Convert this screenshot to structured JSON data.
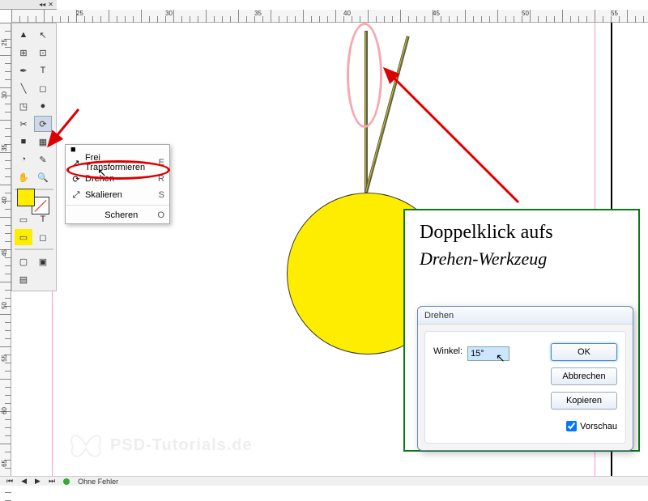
{
  "panel": {
    "tabs_arrow": "◂◂",
    "close": "✕"
  },
  "ruler_h_labels": [
    "25",
    "30",
    "35",
    "40",
    "45",
    "50",
    "55"
  ],
  "ruler_v_labels": [
    "25",
    "30",
    "35",
    "40",
    "45",
    "50",
    "55",
    "60",
    "65"
  ],
  "tools": {
    "row1a": "▲",
    "row1b": "↖",
    "row2a": "⊞",
    "row2b": "⊡",
    "row3a": "✒",
    "row3b": "T",
    "row4a": "╲",
    "row4b": "◻",
    "row5a": "◳",
    "row5b": "●",
    "row6a": "✂",
    "row6b": "⟳",
    "row7a": "■",
    "row7b": "▦",
    "row8a": "◔",
    "row8b": "✎",
    "row9a": "✋",
    "row9b": "🔍",
    "modeA": "▭",
    "modeB": "T",
    "modeC": "▭",
    "modeD": "◻",
    "botA": "▢",
    "botB": "▣",
    "botC": "▤"
  },
  "context_menu": {
    "items": [
      {
        "icon": "↗",
        "label": "Frei Transformieren",
        "key": "E"
      },
      {
        "icon": "⟳",
        "label": "Drehen",
        "key": "R"
      },
      {
        "icon": "⤢",
        "label": "Skalieren",
        "key": "S"
      }
    ],
    "footer": {
      "label": "Scheren",
      "key": "O"
    }
  },
  "tip": {
    "line1": "Doppelklick aufs",
    "line2": "Drehen-Werkzeug"
  },
  "dialog": {
    "title": "Drehen",
    "angle_label": "Winkel:",
    "angle_value": "15°",
    "ok": "OK",
    "cancel": "Abbrechen",
    "copy": "Kopieren",
    "preview": "Vorschau"
  },
  "status": {
    "errors": "Ohne Fehler"
  },
  "watermark": "PSD-Tutorials.de",
  "colors": {
    "yellow": "#ffed00",
    "red_annot": "#d00000",
    "green_box": "#0a7a17"
  }
}
